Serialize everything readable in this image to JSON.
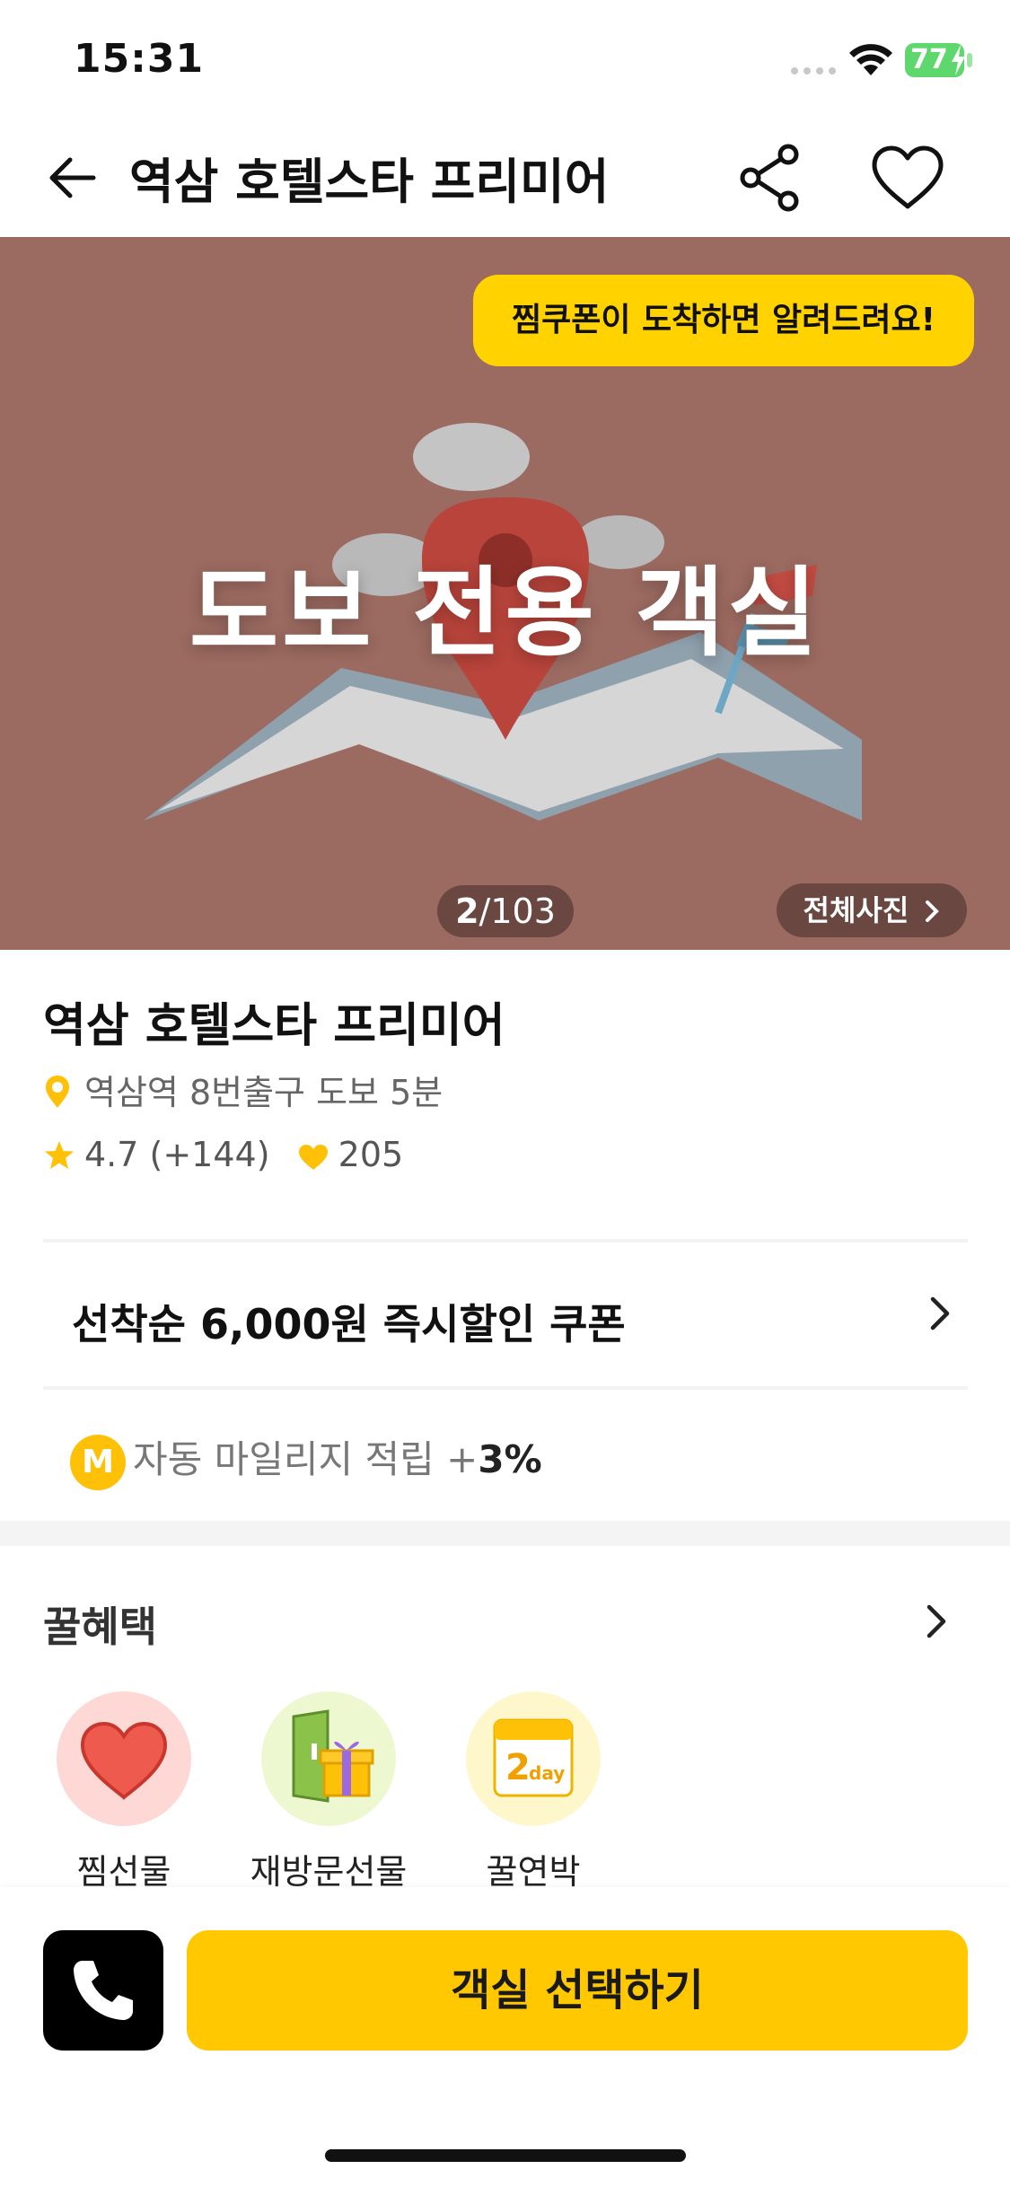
{
  "status_bar": {
    "time": "15:31",
    "battery": "77"
  },
  "header": {
    "title": "역삼 호텔스타 프리미어"
  },
  "hero": {
    "coupon_banner": "찜쿠폰이 도착하면 알려드려요!",
    "caption": "도보 전용 객실",
    "counter_current": "2",
    "counter_total": "/103",
    "all_photos": "전체사진"
  },
  "hotel": {
    "name": "역삼 호텔스타 프리미어",
    "location": "역삼역 8번출구 도보 5분",
    "rating": "4.7 (+144)",
    "likes": "205"
  },
  "coupon": {
    "label": "선착순 6,000원 즉시할인 쿠폰"
  },
  "mileage": {
    "badge": "M",
    "label": "자동 마일리지 적립 +",
    "value": "3%"
  },
  "benefits": {
    "title": "꿀혜택",
    "items": [
      {
        "label": "찜선물"
      },
      {
        "label": "재방문선물"
      },
      {
        "label": "꿀연박"
      }
    ],
    "calendar_number": "2",
    "calendar_text": "day"
  },
  "bottom": {
    "select_label": "객실 선택하기"
  },
  "colors": {
    "accent": "#ffc800",
    "banner": "#ffd200",
    "hero_bg": "#9b6a60"
  }
}
